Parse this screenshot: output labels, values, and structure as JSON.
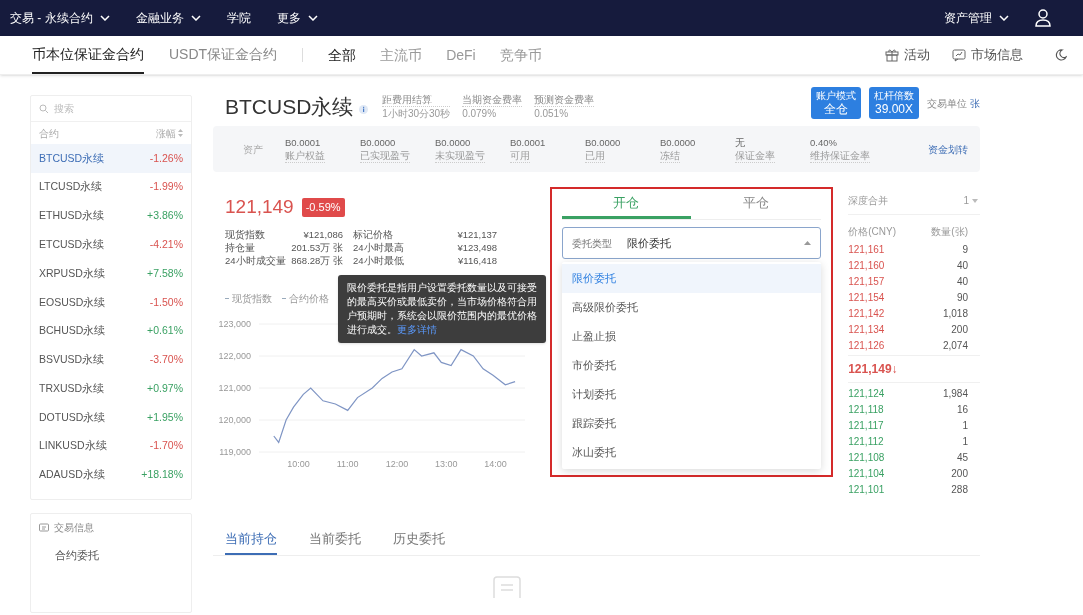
{
  "top_nav": {
    "items": [
      {
        "label": "交易 - 永续合约",
        "dropdown": true
      },
      {
        "label": "金融业务",
        "dropdown": true
      },
      {
        "label": "学院",
        "dropdown": false
      },
      {
        "label": "更多",
        "dropdown": true
      }
    ],
    "right": {
      "label": "资产管理",
      "dropdown": true
    }
  },
  "sub_nav": {
    "tabs": [
      {
        "label": "币本位保证金合约",
        "selected": true
      },
      {
        "label": "USDT保证金合约",
        "selected": false
      }
    ],
    "filters": [
      {
        "label": "全部",
        "selected": true
      },
      {
        "label": "主流币",
        "selected": false
      },
      {
        "label": "DeFi",
        "selected": false
      },
      {
        "label": "竞争币",
        "selected": false
      }
    ],
    "links": [
      {
        "label": "活动",
        "kind": "gift"
      },
      {
        "label": "市场信息",
        "kind": "chat"
      }
    ]
  },
  "sidebar": {
    "search": {
      "placeholder": "搜索"
    },
    "columns": [
      "合约",
      "涨幅"
    ],
    "items": [
      {
        "name": "BTCUSD永续",
        "change": "-1.26%",
        "color": "#d9534f",
        "selected": true
      },
      {
        "name": "LTCUSD永续",
        "change": "-1.99%",
        "color": "#d9534f",
        "selected": false
      },
      {
        "name": "ETHUSD永续",
        "change": "+3.86%",
        "color": "#3aa163",
        "selected": false
      },
      {
        "name": "ETCUSD永续",
        "change": "-4.21%",
        "color": "#d9534f",
        "selected": false
      },
      {
        "name": "XRPUSD永续",
        "change": "+7.58%",
        "color": "#3aa163",
        "selected": false
      },
      {
        "name": "EOSUSD永续",
        "change": "-1.50%",
        "color": "#d9534f",
        "selected": false
      },
      {
        "name": "BCHUSD永续",
        "change": "+0.61%",
        "color": "#3aa163",
        "selected": false
      },
      {
        "name": "BSVUSD永续",
        "change": "-3.70%",
        "color": "#d9534f",
        "selected": false
      },
      {
        "name": "TRXUSD永续",
        "change": "+0.97%",
        "color": "#3aa163",
        "selected": false
      },
      {
        "name": "DOTUSD永续",
        "change": "+1.95%",
        "color": "#3aa163",
        "selected": false
      },
      {
        "name": "LINKUSD永续",
        "change": "-1.70%",
        "color": "#d9534f",
        "selected": false
      },
      {
        "name": "ADAUSD永续",
        "change": "+18.18%",
        "color": "#3aa163",
        "selected": false
      }
    ],
    "info_card": {
      "title": "交易信息",
      "items": [
        "合约委托"
      ]
    }
  },
  "header": {
    "title": "BTCUSD永续",
    "stats": [
      {
        "label": "距费用结算",
        "value": "1小时30分30秒"
      },
      {
        "label": "当期资金费率",
        "value": "0.079%"
      },
      {
        "label": "预测资金费率",
        "value": "0.051%"
      }
    ],
    "buttons": [
      {
        "label": "账户模式",
        "value": "全仓"
      },
      {
        "label": "杠杆倍数",
        "value": "39.00X"
      }
    ],
    "unit_label": "交易单位",
    "unit": "张"
  },
  "assets": {
    "label": "资产",
    "items": [
      {
        "value": "B0.0001",
        "label": "账户权益"
      },
      {
        "value": "B0.0000",
        "label": "已实现盈亏"
      },
      {
        "value": "B0.0000",
        "label": "未实现盈亏"
      },
      {
        "value": "B0.0001",
        "label": "可用"
      },
      {
        "value": "B0.0000",
        "label": "已用"
      },
      {
        "value": "B0.0000",
        "label": "冻结"
      },
      {
        "value": "无",
        "label": "保证金率"
      },
      {
        "value": "0.40%",
        "label": "维持保证金率"
      }
    ],
    "transfer": "资金划转"
  },
  "ticker": {
    "price": "121,149",
    "change": "-0.59%",
    "stats": [
      {
        "label": "现货指数",
        "value": "¥121,086"
      },
      {
        "label": "标记价格",
        "value": "¥121,137"
      },
      {
        "label": "持仓量",
        "value": "201.53万 张"
      },
      {
        "label": "24小时最高",
        "value": "¥123,498"
      },
      {
        "label": "24小时成交量",
        "value": "868.28万 张"
      },
      {
        "label": "24小时最低",
        "value": "¥116,418"
      }
    ]
  },
  "chart": {
    "legend": [
      "现货指数",
      "合约价格"
    ],
    "chart_data": {
      "type": "line",
      "x": [
        9.5,
        9.6,
        9.75,
        9.9,
        10.1,
        10.25,
        10.5,
        10.75,
        11.0,
        11.2,
        11.5,
        11.7,
        11.9,
        12.1,
        12.35,
        12.5,
        12.75,
        12.9,
        13.1,
        13.3,
        13.55,
        13.75,
        13.95,
        14.2,
        14.4
      ],
      "series": [
        {
          "color": "#7f95c4",
          "values": [
            119500,
            119300,
            120000,
            120400,
            120800,
            121000,
            120600,
            120500,
            120300,
            120700,
            121000,
            121300,
            121500,
            121600,
            122200,
            122000,
            122100,
            121800,
            121700,
            122200,
            122000,
            121600,
            121400,
            121100,
            121200
          ]
        }
      ],
      "xlim": [
        9.2,
        14.6
      ],
      "ylim": [
        119000,
        123000
      ],
      "grid": true,
      "xticks": [
        {
          "value": 10,
          "label": "10:00"
        },
        {
          "value": 11,
          "label": "11:00"
        },
        {
          "value": 12,
          "label": "12:00"
        },
        {
          "value": 13,
          "label": "13:00"
        },
        {
          "value": 14,
          "label": "14:00"
        }
      ],
      "yticks": [
        {
          "value": 123000,
          "label": "123,000"
        },
        {
          "value": 122000,
          "label": "122,000"
        },
        {
          "value": 121000,
          "label": "121,000"
        },
        {
          "value": 120000,
          "label": "120,000"
        },
        {
          "value": 119000,
          "label": "119,000"
        }
      ]
    }
  },
  "tooltip": {
    "text": "限价委托是指用户设置委托数量以及可接受的最高买价或最低卖价，当市场价格符合用户预期时，系统会以限价范围内的最优价格进行成交。",
    "link": "更多详情"
  },
  "order_panel": {
    "tabs": [
      {
        "label": "开仓",
        "selected": true
      },
      {
        "label": "平仓",
        "selected": false
      }
    ],
    "select": {
      "label": "委托类型",
      "value": "限价委托",
      "expanded": true
    },
    "options": [
      {
        "label": "限价委托",
        "selected": true
      },
      {
        "label": "高级限价委托",
        "selected": false
      },
      {
        "label": "止盈止损",
        "selected": false
      },
      {
        "label": "市价委托",
        "selected": false
      },
      {
        "label": "计划委托",
        "selected": false
      },
      {
        "label": "跟踪委托",
        "selected": false
      },
      {
        "label": "冰山委托",
        "selected": false
      }
    ]
  },
  "order_book": {
    "depth_label": "深度合并",
    "depth": "1",
    "columns": [
      "价格(CNY)",
      "数量(张)"
    ],
    "asks": [
      {
        "price": "121,161",
        "amount": "9"
      },
      {
        "price": "121,160",
        "amount": "40"
      },
      {
        "price": "121,157",
        "amount": "40"
      },
      {
        "price": "121,154",
        "amount": "90"
      },
      {
        "price": "121,142",
        "amount": "1,018"
      },
      {
        "price": "121,134",
        "amount": "200"
      },
      {
        "price": "121,126",
        "amount": "2,074"
      }
    ],
    "last": "121,149↓",
    "bids": [
      {
        "price": "121,124",
        "amount": "1,984"
      },
      {
        "price": "121,118",
        "amount": "16"
      },
      {
        "price": "121,117",
        "amount": "1"
      },
      {
        "price": "121,112",
        "amount": "1"
      },
      {
        "price": "121,108",
        "amount": "45"
      },
      {
        "price": "121,104",
        "amount": "200"
      },
      {
        "price": "121,101",
        "amount": "288"
      }
    ]
  },
  "bottom_tabs": [
    {
      "label": "当前持仓",
      "selected": true
    },
    {
      "label": "当前委托",
      "selected": false
    },
    {
      "label": "历史委托",
      "selected": false
    }
  ]
}
